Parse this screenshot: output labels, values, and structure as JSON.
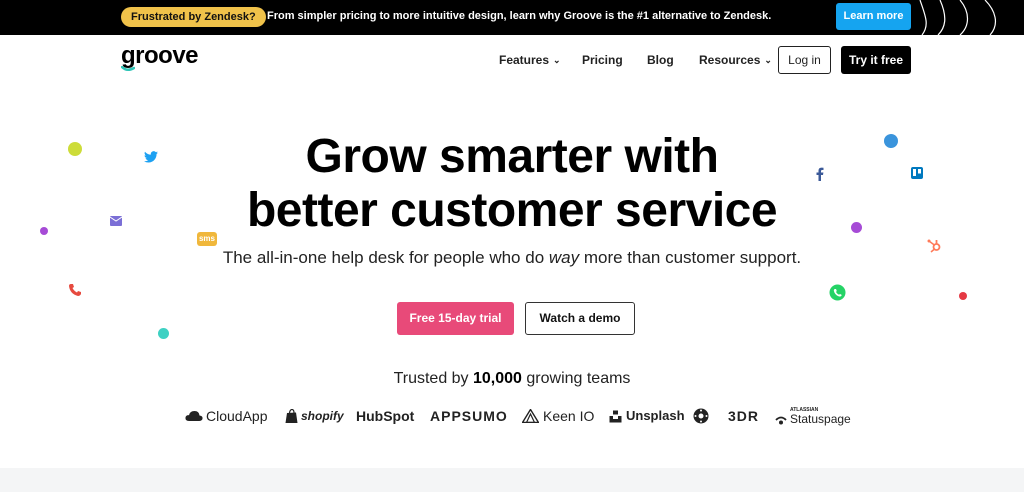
{
  "banner": {
    "pill": "Frustrated by Zendesk?",
    "text": "From simpler pricing to more intuitive design, learn why Groove is the #1 alternative to Zendesk.",
    "button": "Learn more"
  },
  "nav": {
    "logo": "groove",
    "features": "Features",
    "pricing": "Pricing",
    "blog": "Blog",
    "resources": "Resources",
    "login": "Log in",
    "try": "Try it free"
  },
  "hero": {
    "title_line1": "Grow smarter with",
    "title_line2": "better customer service",
    "sub_before": "The all-in-one help desk for people who do ",
    "sub_em": "way",
    "sub_after": " more than customer support.",
    "cta_trial": "Free 15-day trial",
    "cta_demo": "Watch a demo"
  },
  "trusted": {
    "before": "Trusted by ",
    "count": "10,000",
    "after": " growing teams"
  },
  "brands": {
    "cloudapp": "CloudApp",
    "shopify": "shopify",
    "hubspot": "HubSpot",
    "appsumo": "APPSUMO",
    "keenio": "Keen IO",
    "unsplash": "Unsplash",
    "threedr": "3DR",
    "statuspage_small": "ATLASSIAN",
    "statuspage": "Statuspage"
  },
  "decor": {
    "sms_label": "sms"
  },
  "colors": {
    "banner_pill": "#f0c24a",
    "banner_button": "#15a4f0",
    "cta_trial": "#e84a79",
    "logo_accent": "#2ec4b6"
  }
}
